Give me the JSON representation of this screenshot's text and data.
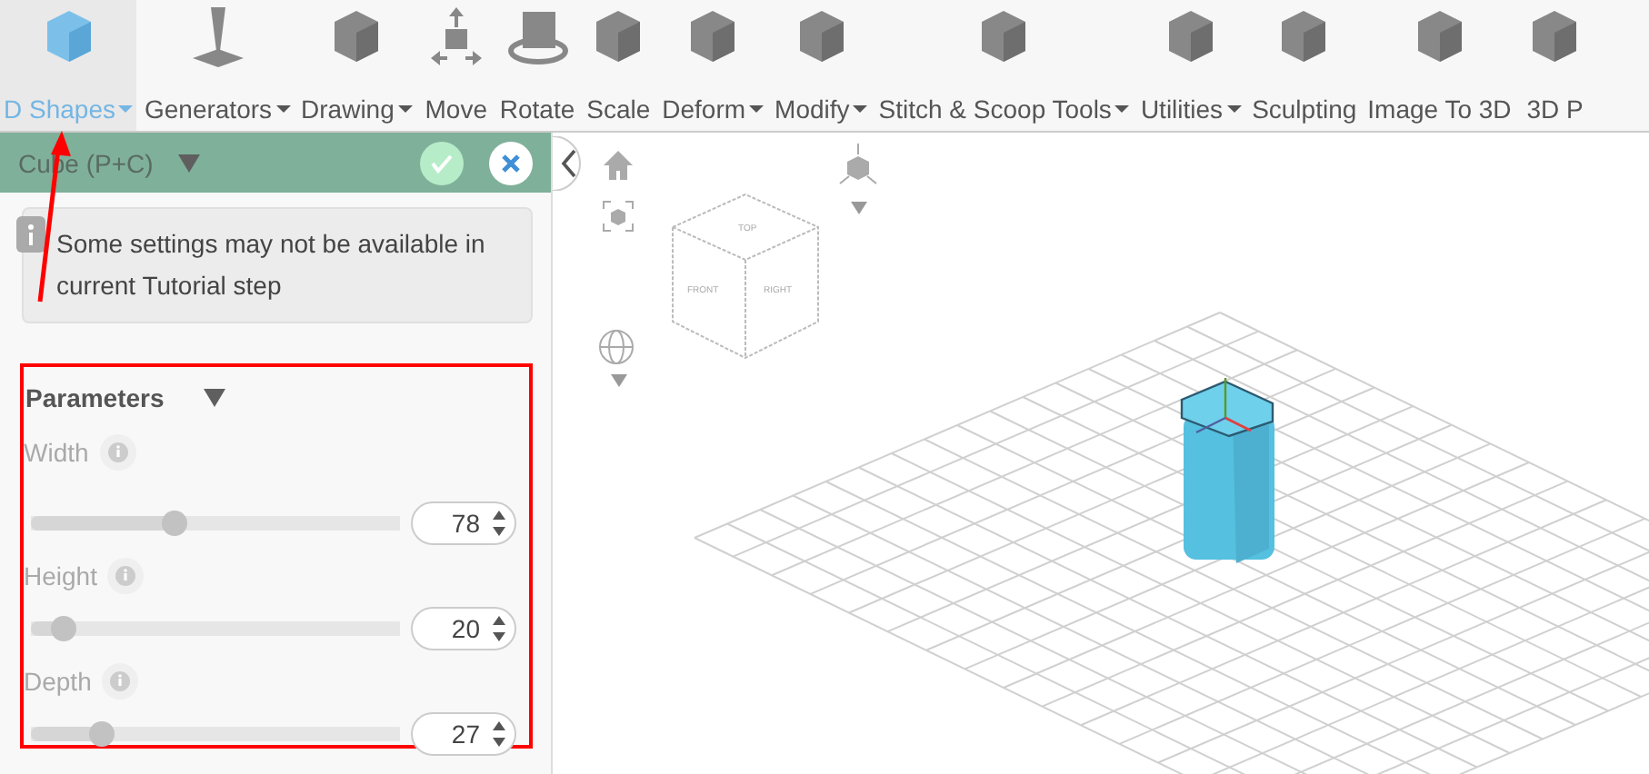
{
  "toolbar": {
    "items": [
      {
        "label": "D Shapes",
        "menu": true,
        "selected": true
      },
      {
        "label": "Generators",
        "menu": true,
        "selected": false
      },
      {
        "label": "Drawing",
        "menu": true,
        "selected": false
      },
      {
        "label": "Move",
        "menu": false,
        "selected": false
      },
      {
        "label": "Rotate",
        "menu": false,
        "selected": false
      },
      {
        "label": "Scale",
        "menu": false,
        "selected": false
      },
      {
        "label": "Deform",
        "menu": true,
        "selected": false
      },
      {
        "label": "Modify",
        "menu": true,
        "selected": false
      },
      {
        "label": "Stitch & Scoop Tools",
        "menu": true,
        "selected": false
      },
      {
        "label": "Utilities",
        "menu": true,
        "selected": false
      },
      {
        "label": "Sculpting",
        "menu": false,
        "selected": false
      },
      {
        "label": "Image To 3D",
        "menu": false,
        "selected": false
      },
      {
        "label": "3D P",
        "menu": false,
        "selected": false
      }
    ]
  },
  "panel": {
    "title": "Cube (P+C)",
    "notice": "Some settings may not be available in current Tutorial step",
    "section": "Parameters",
    "params": [
      {
        "label": "Width",
        "disabled": true,
        "level": 0.39,
        "value": "78"
      },
      {
        "label": "Height",
        "disabled": true,
        "level": 0.09,
        "value": "20"
      },
      {
        "label": "Depth",
        "disabled": true,
        "level": 0.19,
        "value": "27"
      }
    ]
  },
  "viewport": {
    "view_cube": [
      "TOP",
      "FRONT",
      "RIGHT"
    ]
  }
}
